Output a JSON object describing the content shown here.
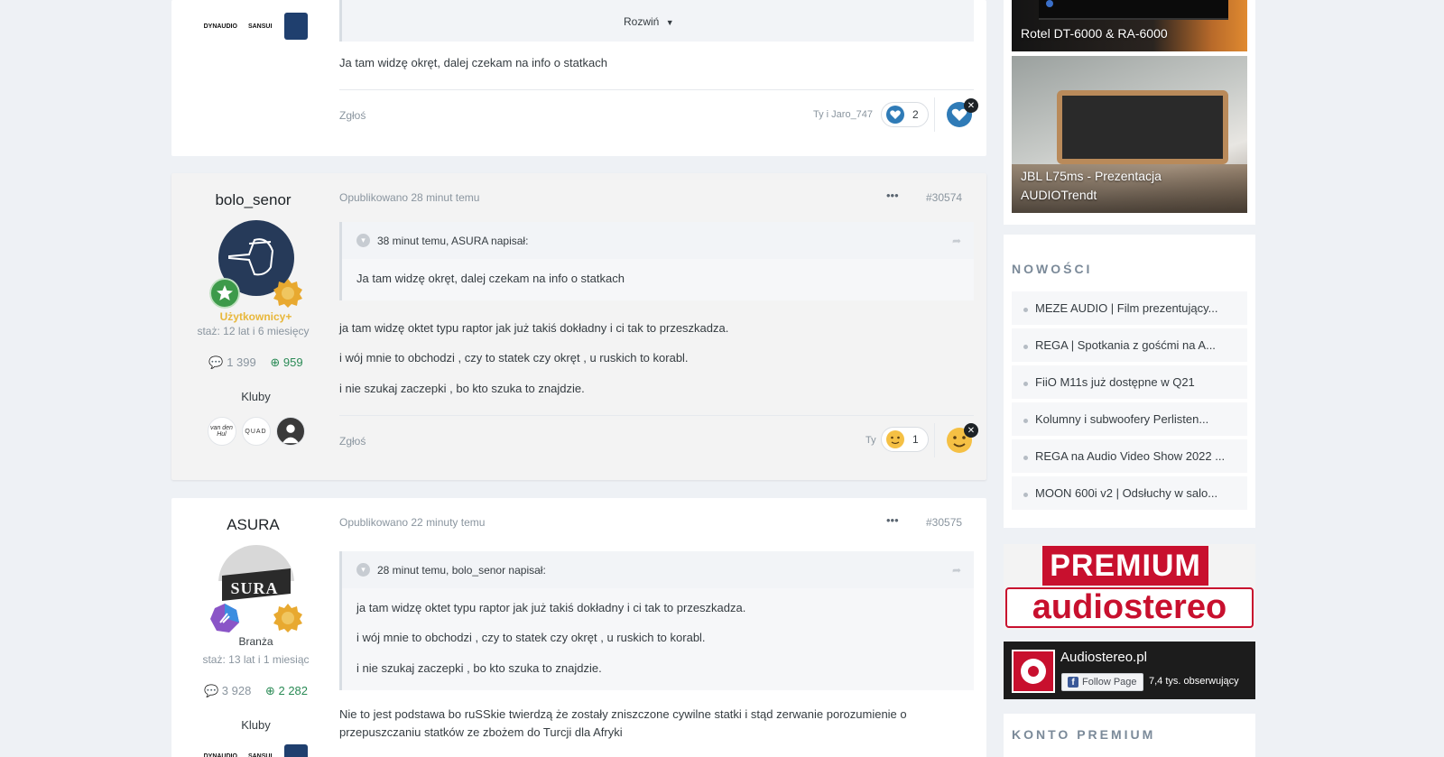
{
  "post0": {
    "expand_label": "Rozwiń",
    "text": "Ja tam widzę okręt, dalej czekam na info o statkach",
    "report_label": "Zgłoś",
    "reactors": "Ty i Jaro_747",
    "reaction_count": "2"
  },
  "post1": {
    "author": "bolo_senor",
    "group": "Użytkownicy+",
    "seniority": "staż: 12 lat i 6 miesięcy",
    "posts_count": "1 399",
    "reputation": "959",
    "clubs_label": "Kluby",
    "clubs": [
      "van den Hul",
      "QUAD",
      ""
    ],
    "published": "Opublikowano 28 minut temu",
    "menu": "•••",
    "number": "#30574",
    "quote_header": "38 minut temu, ASURA napisał:",
    "quote_text": "Ja tam widzę okręt, dalej czekam na info o statkach",
    "paragraphs": [
      "ja tam widzę oktet typu raptor jak już takiś dokładny i ci tak to przeszkadza.",
      "i wój mnie to obchodzi , czy to statek czy okręt , u ruskich to korabl.",
      "i nie szukaj zaczepki , bo kto szuka to znajdzie."
    ],
    "report_label": "Zgłoś",
    "reactors": "Ty",
    "reaction_count": "1"
  },
  "post2": {
    "author": "ASURA",
    "avatar_text": "SURA",
    "group": "Branża",
    "seniority": "staż: 13 lat i 1 miesiąc",
    "posts_count": "3 928",
    "reputation": "2 282",
    "clubs_label": "Kluby",
    "published": "Opublikowano 22 minuty temu",
    "menu": "•••",
    "number": "#30575",
    "quote_header": "28 minut temu, bolo_senor napisał:",
    "quote_paragraphs": [
      "ja tam widzę oktet typu raptor jak już takiś dokładny i ci tak to przeszkadza.",
      "i wój mnie to obchodzi , czy to statek czy okręt , u ruskich to korabl.",
      "i nie szukaj zaczepki , bo kto szuka to znajdzie."
    ],
    "text_line1": "Nie to jest podstawa bo ruSSkie twierdzą że zostały zniszczone cywilne statki i stąd zerwanie porozumienie o",
    "text_line2": "przepuszczaniu statków ze zbożem do  Turcji dla Afryki"
  },
  "club_logos": [
    "DYNAUDIO",
    "SANSUI"
  ],
  "sidebar": {
    "tile1": "Rotel DT-6000 & RA-6000",
    "tile2_line1": "JBL L75ms - Prezentacja",
    "tile2_line2": "AUDIOTrendt",
    "news_title": "NOWOŚCI",
    "news": [
      "MEZE AUDIO | Film prezentujący...",
      "REGA | Spotkania z gośćmi na A...",
      "FiiO M11s już dostępne w Q21",
      "Kolumny i subwoofery Perlisten...",
      "REGA na Audio Video Show 2022 ...",
      "MOON 600i v2 | Odsłuchy w salo..."
    ],
    "premium_top": "PREMIUM",
    "premium_bottom": "audiostereo",
    "fb_name": "Audiostereo.pl",
    "fb_follow": "Follow Page",
    "fb_followers": "7,4 tys. obserwujący",
    "premium_account_title": "KONTO PREMIUM"
  },
  "colors": {
    "like_blue": "#2f7bb7",
    "group_gold": "#e8b73a",
    "rep_green": "#2a8a55",
    "premium_red": "#c8102e"
  }
}
